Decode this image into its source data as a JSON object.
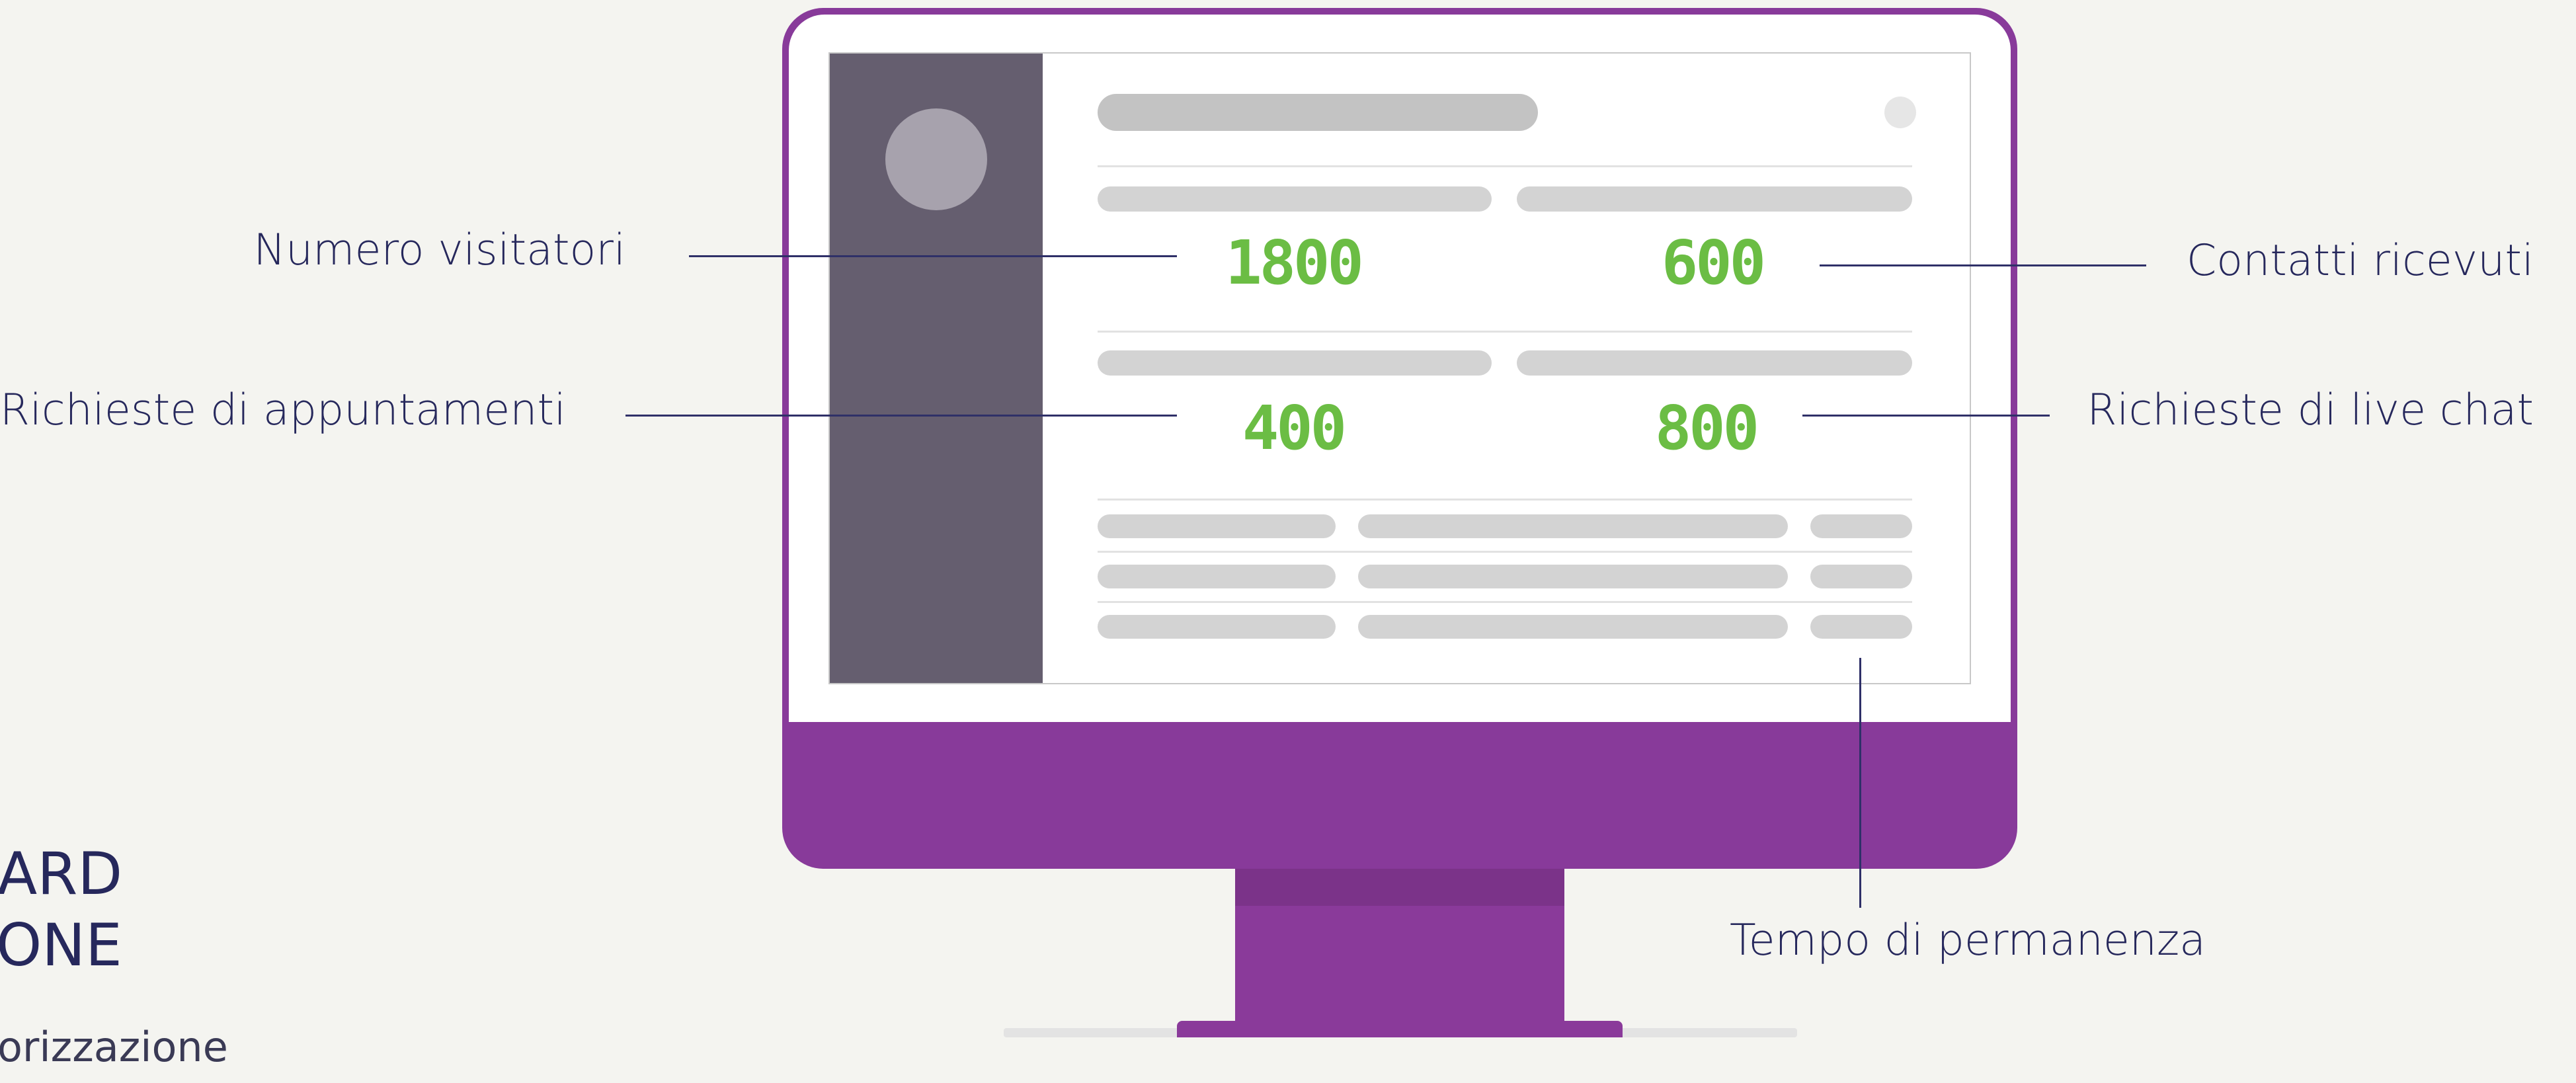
{
  "title": {
    "line1": "ARD",
    "line2": "ONE",
    "subtitle": "orizzazione"
  },
  "dashboard": {
    "visitors": "1800",
    "contacts": "600",
    "appointments": "400",
    "live_chat": "800"
  },
  "labels": {
    "visitors": "Numero visitatori",
    "contacts": "Contatti ricevuti",
    "appointments": "Richieste di appuntamenti",
    "live_chat": "Richieste di live chat",
    "time_on_site": "Tempo di permanenza"
  },
  "colors": {
    "monitor_frame": "#883a9a",
    "sidebar": "#655e6f",
    "metric_value": "#6bbd44",
    "label_text": "#26285c",
    "background": "#f4f4f0"
  }
}
